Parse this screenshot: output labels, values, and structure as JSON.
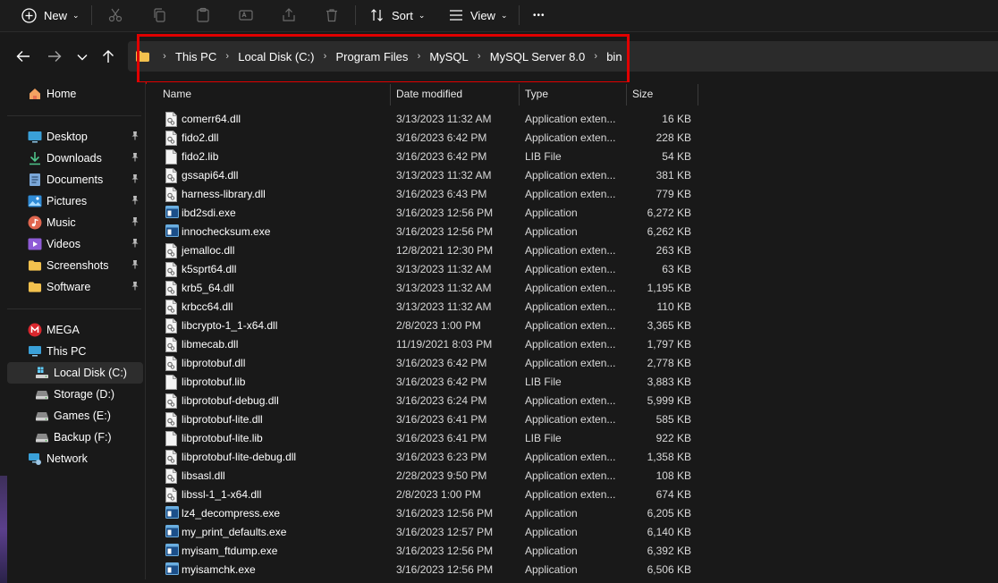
{
  "toolbar": {
    "new_label": "New",
    "sort_label": "Sort",
    "view_label": "View",
    "more_label": "•••"
  },
  "address": {
    "crumbs": [
      "This PC",
      "Local Disk (C:)",
      "Program Files",
      "MySQL",
      "MySQL Server 8.0",
      "bin"
    ]
  },
  "sidebar": {
    "home": "Home",
    "pinned": [
      {
        "label": "Desktop",
        "icon": "desktop-icon"
      },
      {
        "label": "Downloads",
        "icon": "download-icon"
      },
      {
        "label": "Documents",
        "icon": "documents-icon"
      },
      {
        "label": "Pictures",
        "icon": "pictures-icon"
      },
      {
        "label": "Music",
        "icon": "music-icon"
      },
      {
        "label": "Videos",
        "icon": "videos-icon"
      },
      {
        "label": "Screenshots",
        "icon": "folder-icon"
      },
      {
        "label": "Software",
        "icon": "folder-icon"
      }
    ],
    "mega": "MEGA",
    "this_pc": "This PC",
    "drives": [
      {
        "label": "Local Disk (C:)",
        "selected": true
      },
      {
        "label": "Storage (D:)",
        "selected": false
      },
      {
        "label": "Games (E:)",
        "selected": false
      },
      {
        "label": "Backup (F:)",
        "selected": false
      }
    ],
    "network": "Network"
  },
  "columns": {
    "name": "Name",
    "date": "Date modified",
    "type": "Type",
    "size": "Size"
  },
  "files": [
    {
      "name": "comerr64.dll",
      "date": "3/13/2023 11:32 AM",
      "type": "Application exten...",
      "size": "16 KB",
      "kind": "dll"
    },
    {
      "name": "fido2.dll",
      "date": "3/16/2023 6:42 PM",
      "type": "Application exten...",
      "size": "228 KB",
      "kind": "dll"
    },
    {
      "name": "fido2.lib",
      "date": "3/16/2023 6:42 PM",
      "type": "LIB File",
      "size": "54 KB",
      "kind": "lib"
    },
    {
      "name": "gssapi64.dll",
      "date": "3/13/2023 11:32 AM",
      "type": "Application exten...",
      "size": "381 KB",
      "kind": "dll"
    },
    {
      "name": "harness-library.dll",
      "date": "3/16/2023 6:43 PM",
      "type": "Application exten...",
      "size": "779 KB",
      "kind": "dll"
    },
    {
      "name": "ibd2sdi.exe",
      "date": "3/16/2023 12:56 PM",
      "type": "Application",
      "size": "6,272 KB",
      "kind": "exe"
    },
    {
      "name": "innochecksum.exe",
      "date": "3/16/2023 12:56 PM",
      "type": "Application",
      "size": "6,262 KB",
      "kind": "exe"
    },
    {
      "name": "jemalloc.dll",
      "date": "12/8/2021 12:30 PM",
      "type": "Application exten...",
      "size": "263 KB",
      "kind": "dll"
    },
    {
      "name": "k5sprt64.dll",
      "date": "3/13/2023 11:32 AM",
      "type": "Application exten...",
      "size": "63 KB",
      "kind": "dll"
    },
    {
      "name": "krb5_64.dll",
      "date": "3/13/2023 11:32 AM",
      "type": "Application exten...",
      "size": "1,195 KB",
      "kind": "dll"
    },
    {
      "name": "krbcc64.dll",
      "date": "3/13/2023 11:32 AM",
      "type": "Application exten...",
      "size": "110 KB",
      "kind": "dll"
    },
    {
      "name": "libcrypto-1_1-x64.dll",
      "date": "2/8/2023 1:00 PM",
      "type": "Application exten...",
      "size": "3,365 KB",
      "kind": "dll"
    },
    {
      "name": "libmecab.dll",
      "date": "11/19/2021 8:03 PM",
      "type": "Application exten...",
      "size": "1,797 KB",
      "kind": "dll"
    },
    {
      "name": "libprotobuf.dll",
      "date": "3/16/2023 6:42 PM",
      "type": "Application exten...",
      "size": "2,778 KB",
      "kind": "dll"
    },
    {
      "name": "libprotobuf.lib",
      "date": "3/16/2023 6:42 PM",
      "type": "LIB File",
      "size": "3,883 KB",
      "kind": "lib"
    },
    {
      "name": "libprotobuf-debug.dll",
      "date": "3/16/2023 6:24 PM",
      "type": "Application exten...",
      "size": "5,999 KB",
      "kind": "dll"
    },
    {
      "name": "libprotobuf-lite.dll",
      "date": "3/16/2023 6:41 PM",
      "type": "Application exten...",
      "size": "585 KB",
      "kind": "dll"
    },
    {
      "name": "libprotobuf-lite.lib",
      "date": "3/16/2023 6:41 PM",
      "type": "LIB File",
      "size": "922 KB",
      "kind": "lib"
    },
    {
      "name": "libprotobuf-lite-debug.dll",
      "date": "3/16/2023 6:23 PM",
      "type": "Application exten...",
      "size": "1,358 KB",
      "kind": "dll"
    },
    {
      "name": "libsasl.dll",
      "date": "2/28/2023 9:50 PM",
      "type": "Application exten...",
      "size": "108 KB",
      "kind": "dll"
    },
    {
      "name": "libssl-1_1-x64.dll",
      "date": "2/8/2023 1:00 PM",
      "type": "Application exten...",
      "size": "674 KB",
      "kind": "dll"
    },
    {
      "name": "lz4_decompress.exe",
      "date": "3/16/2023 12:56 PM",
      "type": "Application",
      "size": "6,205 KB",
      "kind": "exe"
    },
    {
      "name": "my_print_defaults.exe",
      "date": "3/16/2023 12:57 PM",
      "type": "Application",
      "size": "6,140 KB",
      "kind": "exe"
    },
    {
      "name": "myisam_ftdump.exe",
      "date": "3/16/2023 12:56 PM",
      "type": "Application",
      "size": "6,392 KB",
      "kind": "exe"
    },
    {
      "name": "myisamchk.exe",
      "date": "3/16/2023 12:56 PM",
      "type": "Application",
      "size": "6,506 KB",
      "kind": "exe"
    }
  ],
  "colors": {
    "background": "#191919",
    "highlight_box": "#e00000",
    "folder": "#f2c14e",
    "accent": "#60cdff"
  }
}
